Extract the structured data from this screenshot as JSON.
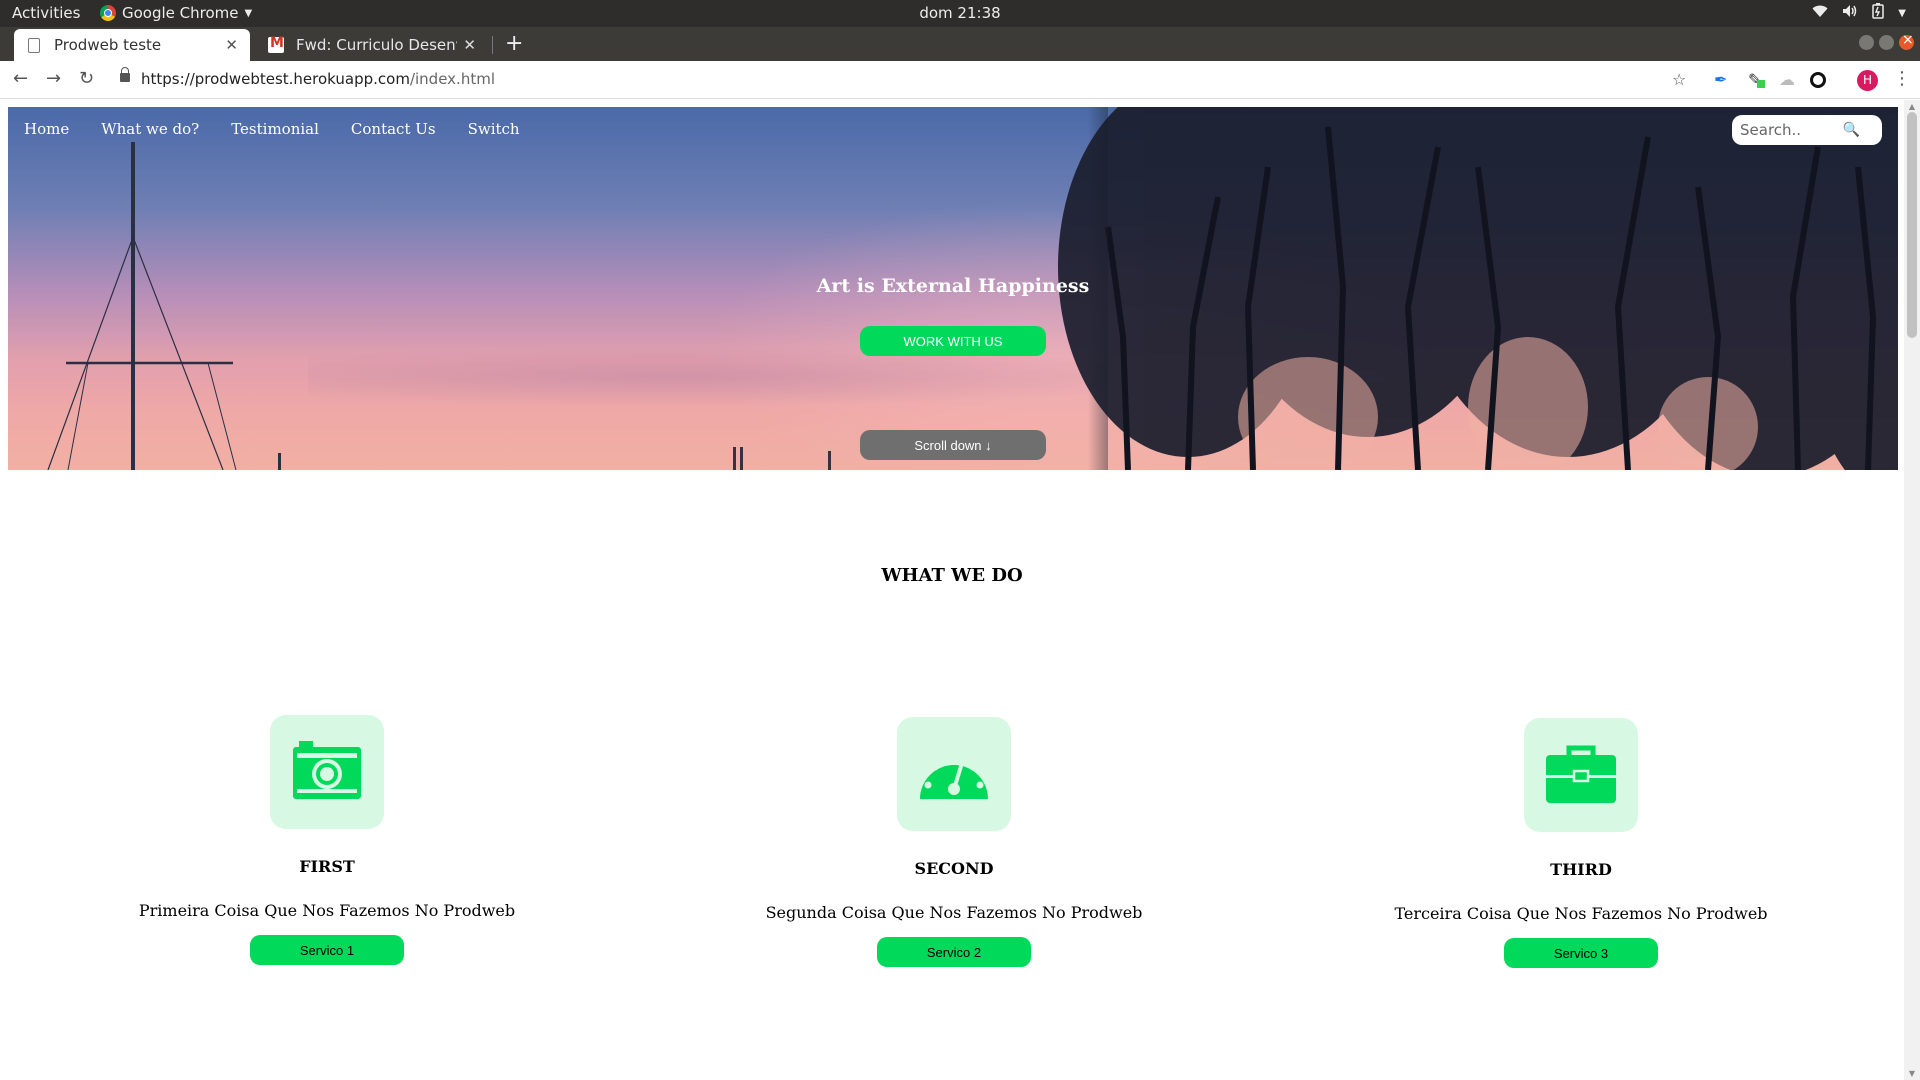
{
  "os": {
    "activities": "Activities",
    "app_name": "Google Chrome",
    "clock": "dom 21:38"
  },
  "browser": {
    "tabs": [
      {
        "title": "Prodweb teste",
        "active": true
      },
      {
        "title": "Fwd: Curriculo Desenvolv",
        "active": false
      }
    ],
    "url_host": "https://prodwebtest.herokuapp.com",
    "url_path": "/index.html",
    "avatar_letter": "H"
  },
  "site": {
    "nav": [
      "Home",
      "What we do?",
      "Testimonial",
      "Contact Us",
      "Switch"
    ],
    "search_placeholder": "Search..",
    "hero": {
      "title": "Art is External Happiness",
      "cta": "WORK WITH US",
      "scroll": "Scroll down ↓"
    },
    "section_title": "WHAT WE DO",
    "services": [
      {
        "icon": "camera-icon",
        "heading": "FIRST",
        "text": "Primeira Coisa Que Nos Fazemos No Prodweb",
        "button": "Servico 1"
      },
      {
        "icon": "speedometer-icon",
        "heading": "SECOND",
        "text": "Segunda Coisa Que Nos Fazemos No Prodweb",
        "button": "Servico 2"
      },
      {
        "icon": "briefcase-icon",
        "heading": "THIRD",
        "text": "Terceira Coisa Que Nos Fazemos No Prodweb",
        "button": "Servico 3"
      }
    ],
    "colors": {
      "accent": "#00d95a",
      "icon_bg": "#d7f8e2"
    }
  }
}
